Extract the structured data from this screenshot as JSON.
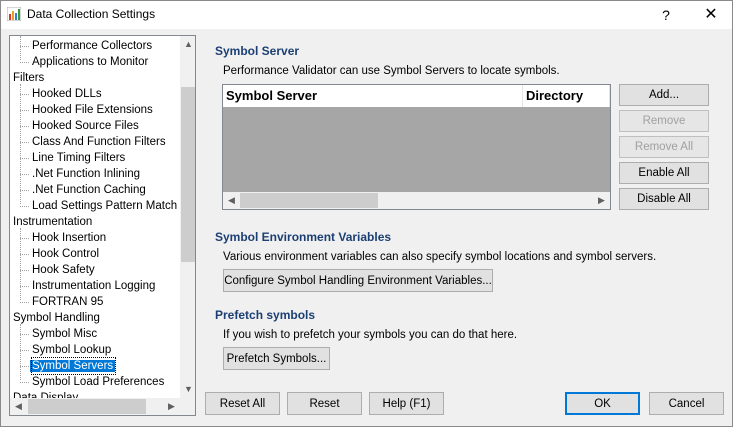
{
  "window": {
    "title": "Data Collection Settings",
    "help_glyph": "?",
    "close_glyph": "✕"
  },
  "tree": {
    "items": [
      {
        "label": "Performance Collectors",
        "level": 1
      },
      {
        "label": "Applications to Monitor",
        "level": 1
      },
      {
        "label": "Filters",
        "level": 0
      },
      {
        "label": "Hooked DLLs",
        "level": 1
      },
      {
        "label": "Hooked File Extensions",
        "level": 1
      },
      {
        "label": "Hooked Source Files",
        "level": 1
      },
      {
        "label": "Class And Function Filters",
        "level": 1
      },
      {
        "label": "Line Timing Filters",
        "level": 1
      },
      {
        "label": ".Net Function Inlining",
        "level": 1
      },
      {
        "label": ".Net Function Caching",
        "level": 1
      },
      {
        "label": "Load Settings Pattern Match",
        "level": 1
      },
      {
        "label": "Instrumentation",
        "level": 0
      },
      {
        "label": "Hook Insertion",
        "level": 1
      },
      {
        "label": "Hook Control",
        "level": 1
      },
      {
        "label": "Hook Safety",
        "level": 1
      },
      {
        "label": "Instrumentation Logging",
        "level": 1
      },
      {
        "label": "FORTRAN 95",
        "level": 1
      },
      {
        "label": "Symbol Handling",
        "level": 0
      },
      {
        "label": "Symbol Misc",
        "level": 1
      },
      {
        "label": "Symbol Lookup",
        "level": 1
      },
      {
        "label": "Symbol Servers",
        "level": 1,
        "selected": true
      },
      {
        "label": "Symbol Load Preferences",
        "level": 1
      },
      {
        "label": "Data Display",
        "level": 0
      }
    ]
  },
  "symbol_server": {
    "title": "Symbol Server",
    "description": "Performance Validator can use Symbol Servers to locate symbols.",
    "columns": [
      "Symbol Server",
      "Directory"
    ],
    "rows": [],
    "buttons": {
      "add": "Add...",
      "remove": "Remove",
      "remove_all": "Remove All",
      "enable_all": "Enable All",
      "disable_all": "Disable All"
    }
  },
  "env_vars": {
    "title": "Symbol Environment Variables",
    "description": "Various environment variables can also specify symbol locations and symbol servers.",
    "button": "Configure Symbol Handling Environment Variables..."
  },
  "prefetch": {
    "title": "Prefetch symbols",
    "description": "If you wish to prefetch your symbols you can do that here.",
    "button": "Prefetch Symbols..."
  },
  "footer": {
    "reset_all": "Reset All",
    "reset": "Reset",
    "help": "Help (F1)",
    "ok": "OK",
    "cancel": "Cancel"
  },
  "icons": {
    "scroll_up": "▲",
    "scroll_down": "▼",
    "scroll_left": "◀",
    "scroll_right": "▶"
  }
}
